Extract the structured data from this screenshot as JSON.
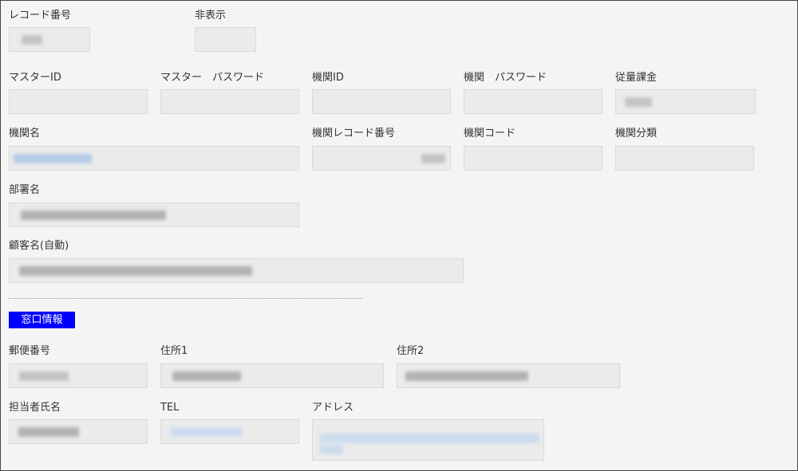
{
  "form": {
    "labels": {
      "record_number": "レコード番号",
      "hidden": "非表示",
      "master_id": "マスターID",
      "master_password": "マスター　パスワード",
      "institution_id": "機関ID",
      "institution_password": "機関　パスワード",
      "usage_billing": "従量課金",
      "institution_name": "機関名",
      "institution_record_number": "機関レコード番号",
      "institution_code": "機関コード",
      "institution_category": "機関分類",
      "department_name": "部署名",
      "customer_name_auto": "顧客名(自動)",
      "postal_code": "郵便番号",
      "address1": "住所1",
      "address2": "住所2",
      "contact_person_name": "担当者氏名",
      "tel": "TEL",
      "email_address": "アドレス"
    },
    "section_title": "窓口情報"
  }
}
